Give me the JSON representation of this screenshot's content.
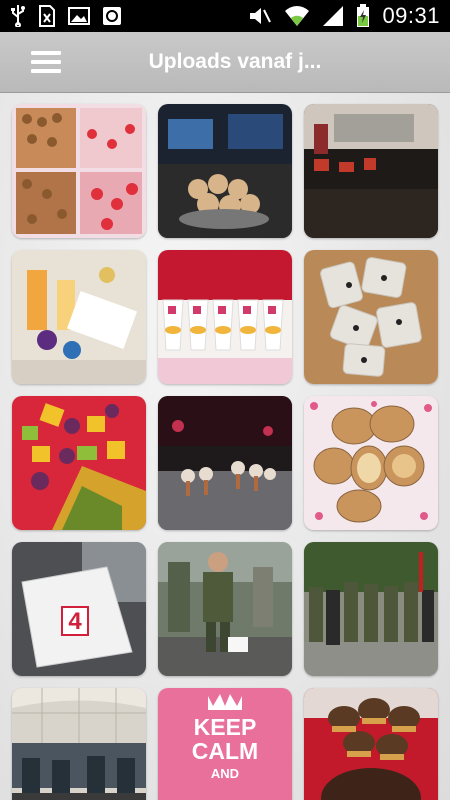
{
  "status_bar": {
    "time": "09:31",
    "icons": [
      "usb-icon",
      "sim-icon",
      "image-icon",
      "app-notification-icon",
      "mute-icon",
      "wifi-icon",
      "signal-icon",
      "battery-icon"
    ]
  },
  "app_bar": {
    "menu_icon": "hamburger-menu-icon",
    "title": "Uploads vanaf j..."
  },
  "gallery": {
    "keep_calm": {
      "line1": "KEEP",
      "line2": "CALM",
      "line3": "AND"
    },
    "badge_number": "4"
  },
  "colors": {
    "status_bar_bg": "#000000",
    "app_bar_bg": "#c2c2c2",
    "title_text": "#ffffff",
    "keep_calm_pink": "#e8709a"
  }
}
